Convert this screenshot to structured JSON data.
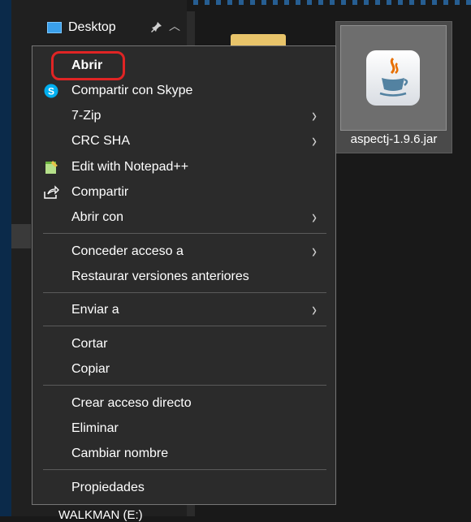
{
  "nav": {
    "desktop_label": "Desktop",
    "drive_label": "WALKMAN (E:)",
    "icons": [
      "desktop-icon",
      "pin-icon",
      "chevron-up-icon"
    ]
  },
  "file": {
    "name": "aspectj-1.9.6.jar",
    "icon": "java-jar-icon"
  },
  "menu": {
    "open": "Abrir",
    "skype": "Compartir con Skype",
    "zip": "7-Zip",
    "crc": "CRC SHA",
    "notepad": "Edit with Notepad++",
    "share": "Compartir",
    "open_with": "Abrir con",
    "grant_access": "Conceder acceso a",
    "restore": "Restaurar versiones anteriores",
    "send_to": "Enviar a",
    "cut": "Cortar",
    "copy": "Copiar",
    "shortcut": "Crear acceso directo",
    "delete": "Eliminar",
    "rename": "Cambiar nombre",
    "properties": "Propiedades",
    "submenu_arrow": "›"
  },
  "colors": {
    "menu_bg": "#2b2b2b",
    "highlight_ring": "#e02424",
    "skype_blue": "#00aff0"
  }
}
